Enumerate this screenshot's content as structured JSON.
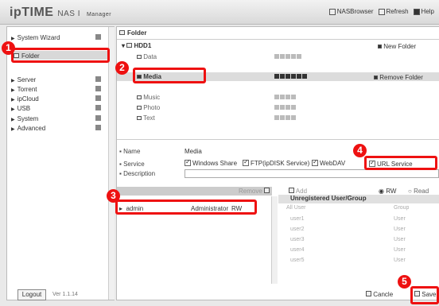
{
  "app": {
    "logo": "ipTIME",
    "product": "NAS I",
    "sub": "Manager"
  },
  "top_links": {
    "browser": "NASBrowser",
    "refresh": "Refresh",
    "help": "Help"
  },
  "sidebar": {
    "items": [
      {
        "label": "System Wizard"
      },
      {
        "label": "Folder"
      },
      {
        "label": "Server"
      },
      {
        "label": "Torrent"
      },
      {
        "label": "ipCloud"
      },
      {
        "label": "USB"
      },
      {
        "label": "System"
      },
      {
        "label": "Advanced"
      }
    ],
    "logout": "Logout",
    "version": "Ver 1.1.14"
  },
  "tree": {
    "root": "Folder",
    "drive": "HDD1",
    "new_folder": "New Folder",
    "remove_folder": "Remove Folder",
    "folders": [
      "Data",
      "Media",
      "Music",
      "Photo",
      "Text"
    ]
  },
  "form": {
    "name_label": "Name",
    "name_value": "Media",
    "service_label": "Service",
    "description_label": "Description",
    "services": [
      "Windows Share",
      "FTP(ipDISK Service)",
      "WebDAV",
      "URL Service"
    ]
  },
  "users": {
    "registered": [
      {
        "name": "admin",
        "group": "Administrator",
        "perm": "RW"
      }
    ],
    "unregistered_header": "Unregistered User/Group",
    "remove_btn": "Remove",
    "add_btn": "Add",
    "rw_label": "RW",
    "ro_label": "Read Onl",
    "unregistered": [
      {
        "name": "All User",
        "type": "Group"
      },
      {
        "name": "user1",
        "type": "User"
      },
      {
        "name": "user2",
        "type": "User"
      },
      {
        "name": "user3",
        "type": "User"
      },
      {
        "name": "user4",
        "type": "User"
      },
      {
        "name": "user5",
        "type": "User"
      }
    ]
  },
  "buttons": {
    "cancel": "Cancle",
    "save": "Save"
  },
  "callouts": [
    "1",
    "2",
    "3",
    "4",
    "5"
  ],
  "colors": {
    "accent": "#e11111"
  }
}
